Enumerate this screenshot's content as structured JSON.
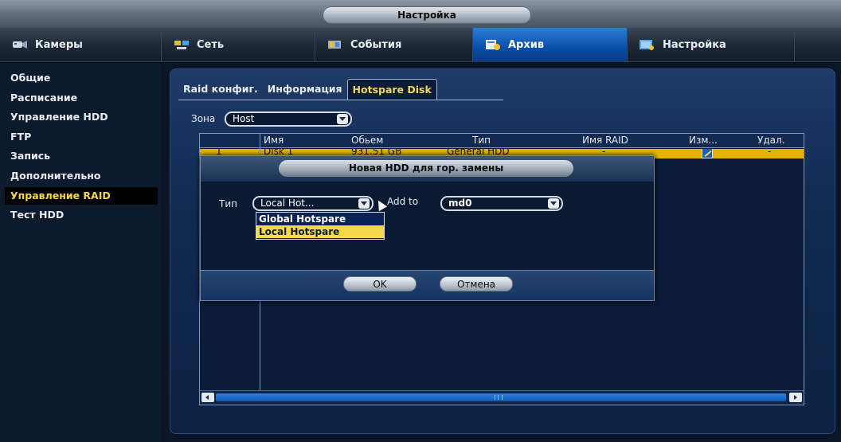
{
  "window": {
    "title": "Настройка"
  },
  "tabs": [
    {
      "label": "Камеры",
      "icon": "camera-icon"
    },
    {
      "label": "Сеть",
      "icon": "network-icon"
    },
    {
      "label": "События",
      "icon": "events-icon"
    },
    {
      "label": "Архив",
      "icon": "archive-icon",
      "active": true
    },
    {
      "label": "Настройка",
      "icon": "settings-icon"
    }
  ],
  "sidebar": {
    "items": [
      {
        "label": "Общие"
      },
      {
        "label": "Расписание"
      },
      {
        "label": "Управление HDD"
      },
      {
        "label": "FTP"
      },
      {
        "label": "Запись"
      },
      {
        "label": "Дополнительно"
      },
      {
        "label": "Управление RAID",
        "active": true
      },
      {
        "label": "Тест HDD"
      }
    ]
  },
  "subtabs": [
    {
      "label": "Raid конфиг."
    },
    {
      "label": "Информация"
    },
    {
      "label": "Hotspare Disk",
      "active": true
    }
  ],
  "zone": {
    "label": "Зона",
    "value": "Host"
  },
  "table": {
    "columns": [
      "",
      "Имя",
      "Обьем",
      "Тип",
      "Имя RAID",
      "Изм...",
      "Удал."
    ],
    "rows": [
      {
        "index": "1",
        "name": "Disk 1",
        "capacity": "931.51 GB",
        "type": "General HDD",
        "raid": "-",
        "delete": "-"
      }
    ]
  },
  "dialog": {
    "title": "Новая HDD для гор. замены",
    "type_label": "Тип",
    "type_value": "Local Hot...",
    "type_options": [
      "Global Hotspare",
      "Local Hotspare"
    ],
    "highlighted_option": "Local Hotspare",
    "addto_label": "Add to",
    "addto_value": "md0",
    "ok_label": "OK",
    "cancel_label": "Отмена"
  },
  "colors": {
    "accent": "#0a4fa6",
    "highlight": "#f5d84a",
    "row_selected": "#e6b400"
  }
}
